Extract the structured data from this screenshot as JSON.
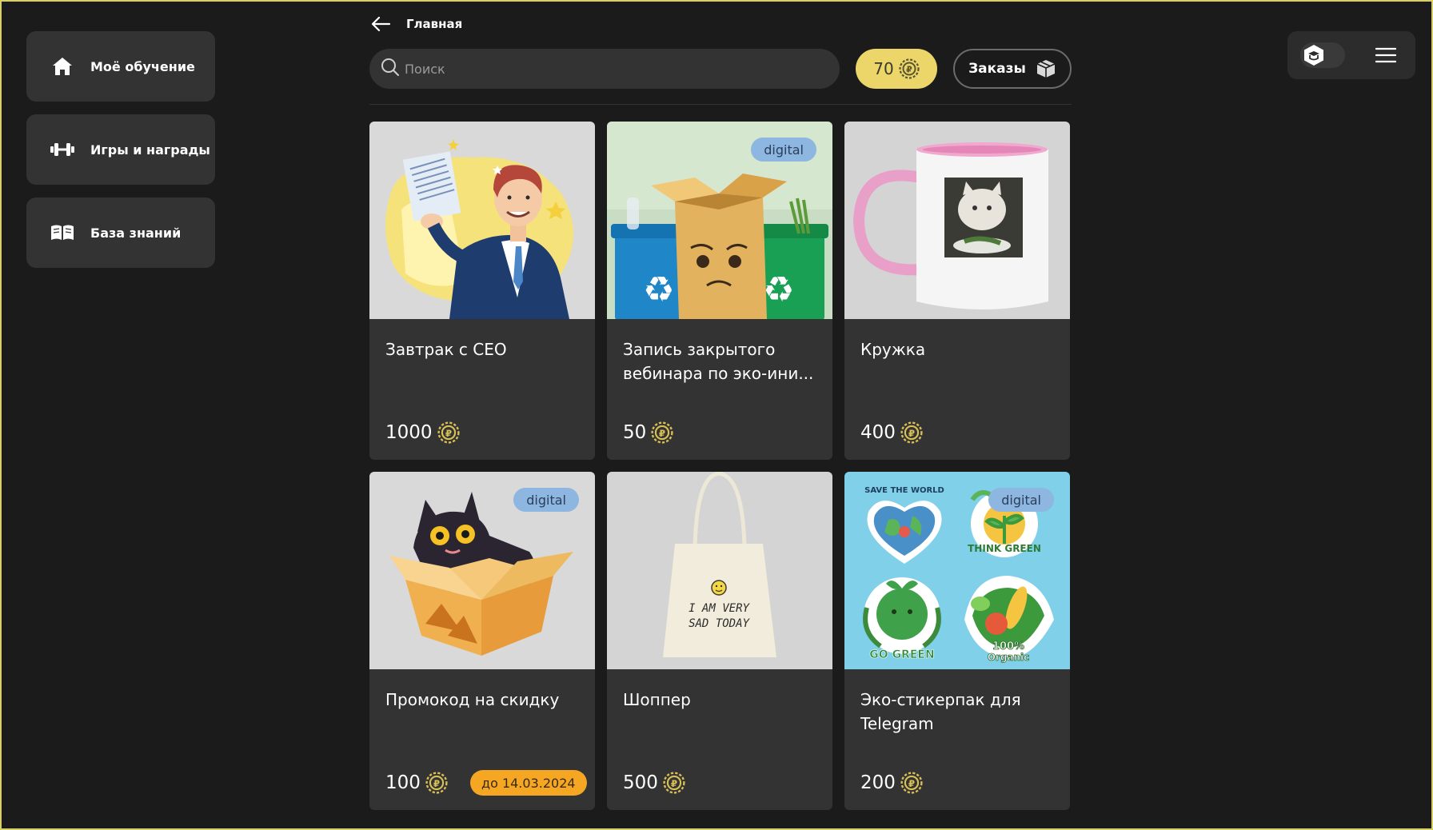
{
  "sidebar": {
    "items": [
      {
        "label": "Моё обучение",
        "icon": "home-icon"
      },
      {
        "label": "Игры и награды",
        "icon": "dumbbell-icon"
      },
      {
        "label": "База знаний",
        "icon": "book-icon"
      }
    ]
  },
  "header": {
    "breadcrumb": "Главная",
    "search_placeholder": "Поиск",
    "balance": "70",
    "orders_label": "Заказы"
  },
  "colors": {
    "background": "#1b1b1b",
    "card": "#333333",
    "accent_yellow": "#ecd66a",
    "badge_blue": "#8db6e0",
    "deadline_orange": "#f5a623"
  },
  "products": [
    {
      "title": "Завтрак с CEO",
      "price": "1000",
      "badge": "",
      "deadline": ""
    },
    {
      "title": "Запись закрытого вебинара по эко-ини...",
      "price": "50",
      "badge": "digital",
      "deadline": ""
    },
    {
      "title": "Кружка",
      "price": "400",
      "badge": "",
      "deadline": ""
    },
    {
      "title": "Промокод на скидку",
      "price": "100",
      "badge": "digital",
      "deadline": "до 14.03.2024"
    },
    {
      "title": "Шоппер",
      "price": "500",
      "badge": "",
      "deadline": "",
      "print_lines": [
        "I AM VERY",
        "SAD TODAY"
      ]
    },
    {
      "title": "Эко-стикерпак для Telegram",
      "price": "200",
      "badge": "digital",
      "deadline": "",
      "sticker_texts": [
        "SAVE THE WORLD",
        "THINK GREEN",
        "GO GREEN",
        "100%",
        "Organic"
      ]
    }
  ]
}
